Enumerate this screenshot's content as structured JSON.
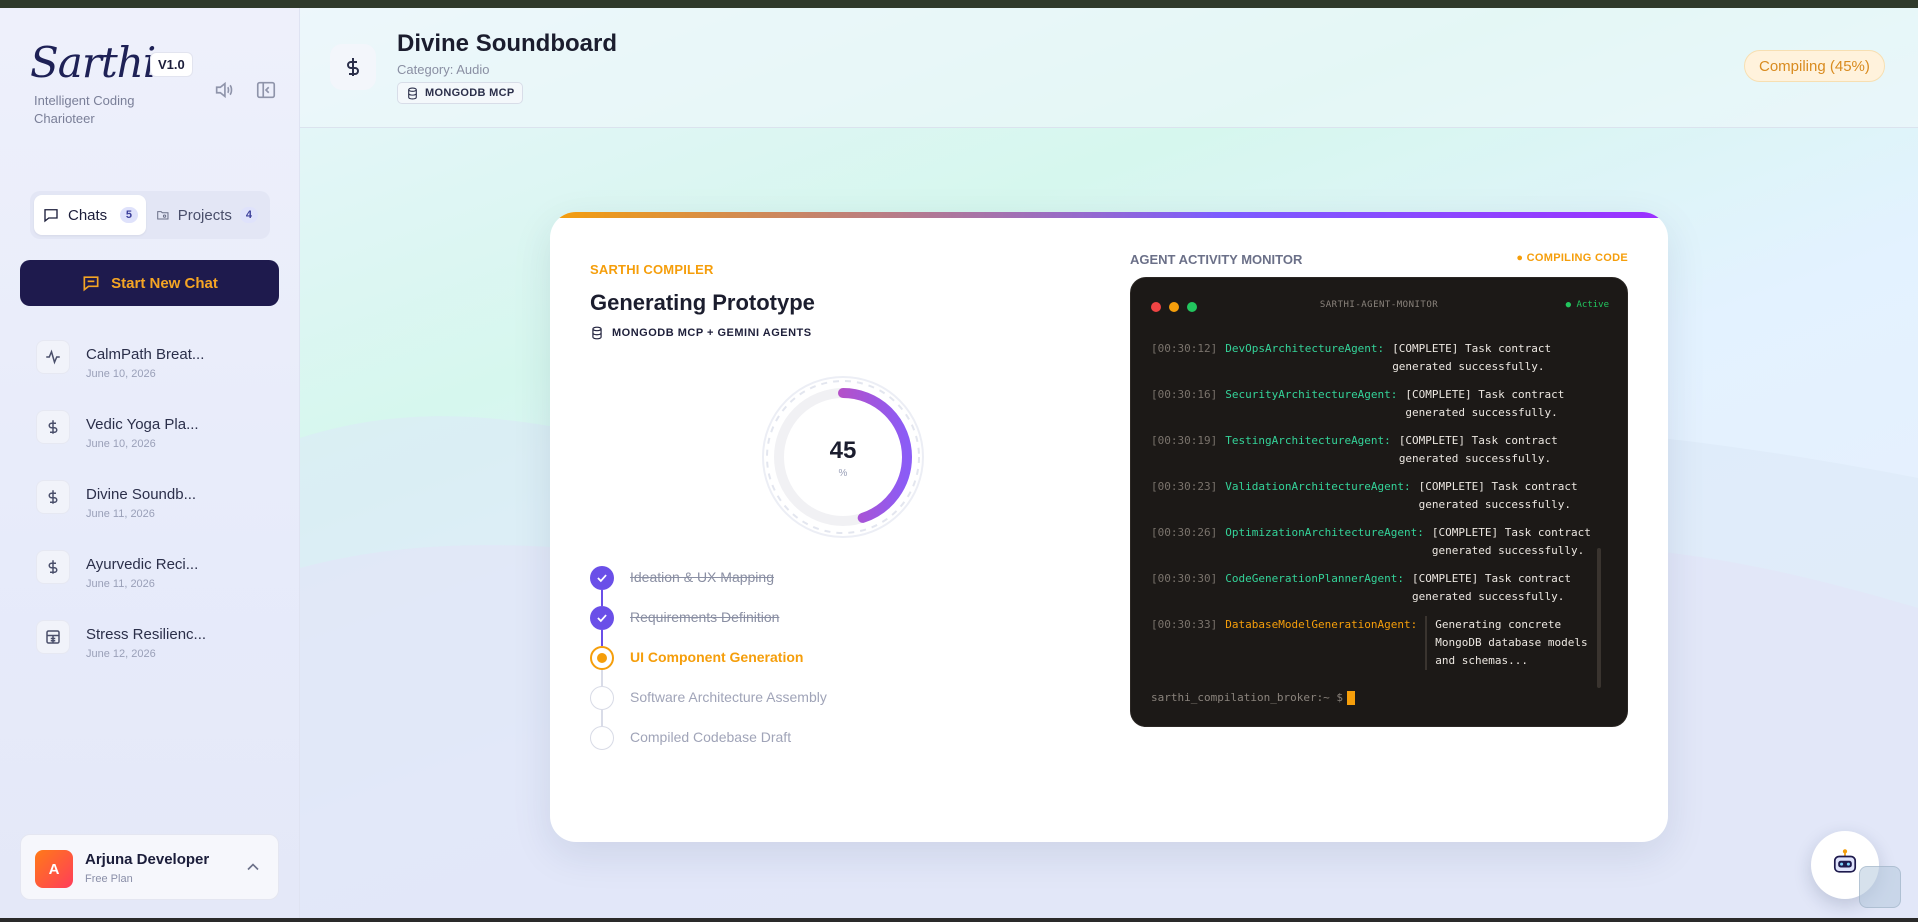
{
  "sidebar": {
    "logo": "Sarthi",
    "version": "V1.0",
    "tagline": "Intelligent Coding Charioteer",
    "tabs": [
      {
        "label": "Chats",
        "count": "5"
      },
      {
        "label": "Projects",
        "count": "4"
      }
    ],
    "new_chat_label": "Start New Chat",
    "chats": [
      {
        "title": "CalmPath Breat...",
        "date": "June 10, 2026",
        "icon": "activity-icon"
      },
      {
        "title": "Vedic Yoga Pla...",
        "date": "June 10, 2026",
        "icon": "dollar-icon"
      },
      {
        "title": "Divine Soundb...",
        "date": "June 11, 2026",
        "icon": "dollar-icon"
      },
      {
        "title": "Ayurvedic Reci...",
        "date": "June 11, 2026",
        "icon": "dollar-icon"
      },
      {
        "title": "Stress Resilienc...",
        "date": "June 12, 2026",
        "icon": "calculator-icon"
      }
    ],
    "user": {
      "initial": "A",
      "name": "Arjuna Developer",
      "plan": "Free Plan"
    }
  },
  "header": {
    "title": "Divine Soundboard",
    "category": "Category: Audio",
    "chip": "MONGODB MCP",
    "status": "Compiling (45%)"
  },
  "compiler": {
    "label": "SARTHI COMPILER",
    "title": "Generating Prototype",
    "subtitle": "MONGODB MCP + GEMINI AGENTS",
    "progress_value": "45",
    "progress_unit": "%",
    "progress_fraction": 0.45,
    "steps": [
      {
        "label": "Ideation & UX Mapping",
        "state": "done"
      },
      {
        "label": "Requirements Definition",
        "state": "done"
      },
      {
        "label": "UI Component Generation",
        "state": "active"
      },
      {
        "label": "Software Architecture Assembly",
        "state": "todo"
      },
      {
        "label": "Compiled Codebase Draft",
        "state": "todo"
      }
    ]
  },
  "monitor": {
    "label": "AGENT ACTIVITY MONITOR",
    "status": "● COMPILING CODE",
    "terminal_name": "SARTHI-AGENT-MONITOR",
    "terminal_active": "● Active",
    "logs": [
      {
        "time": "[00:30:12]",
        "agent": "DevOpsArchitectureAgent:",
        "msg": "[COMPLETE] Task contract generated successfully.",
        "state": "complete"
      },
      {
        "time": "[00:30:16]",
        "agent": "SecurityArchitectureAgent:",
        "msg": "[COMPLETE] Task contract generated successfully.",
        "state": "complete"
      },
      {
        "time": "[00:30:19]",
        "agent": "TestingArchitectureAgent:",
        "msg": "[COMPLETE] Task contract generated successfully.",
        "state": "complete"
      },
      {
        "time": "[00:30:23]",
        "agent": "ValidationArchitectureAgent:",
        "msg": "[COMPLETE] Task contract generated successfully.",
        "state": "complete"
      },
      {
        "time": "[00:30:26]",
        "agent": "OptimizationArchitectureAgent:",
        "msg": "[COMPLETE] Task contract generated successfully.",
        "state": "complete"
      },
      {
        "time": "[00:30:30]",
        "agent": "CodeGenerationPlannerAgent:",
        "msg": "[COMPLETE] Task contract generated successfully.",
        "state": "complete"
      },
      {
        "time": "[00:30:33]",
        "agent": "DatabaseModelGenerationAgent:",
        "msg": "Generating concrete MongoDB database models and schemas...",
        "state": "running"
      }
    ],
    "prompt": "sarthi_compilation_broker:~ $"
  },
  "colors": {
    "accent": "#f59e0b",
    "brand_dark": "#1e1a4d",
    "progress_start": "#d946a0",
    "progress_end": "#8b5cf6",
    "agent_green": "#34d399"
  }
}
